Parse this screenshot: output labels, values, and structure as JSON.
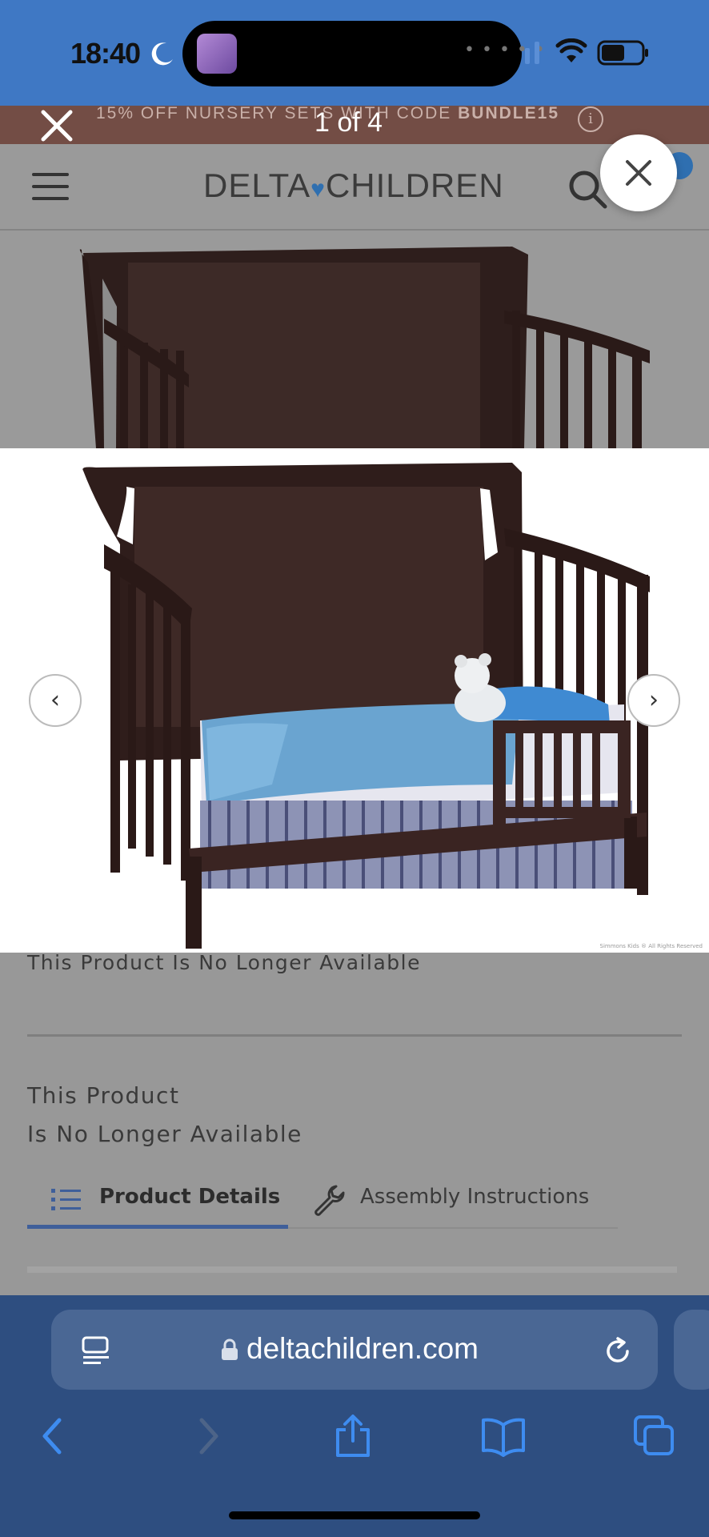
{
  "status_bar": {
    "time": "18:40",
    "battery_level": 0.6
  },
  "promo": {
    "text": "15% OFF NURSERY SETS WITH CODE",
    "code": "BUNDLE15",
    "info_icon": "i"
  },
  "viewer": {
    "counter": "1 of 4",
    "close_icon": "close-icon"
  },
  "site": {
    "logo_left": "DELTA",
    "logo_right": "CHILDREN"
  },
  "gallery": {
    "prev_icon": "‹",
    "next_icon": "›",
    "copyright": "Simmons Kids ® All Rights Reserved"
  },
  "product": {
    "unavailable_text": "This Product Is No Longer Available",
    "unavailable_line1": "This Product",
    "unavailable_line2": "Is No Longer Available"
  },
  "tabs": [
    {
      "label": "Product Details",
      "active": true
    },
    {
      "label": "Assembly Instructions",
      "active": false
    }
  ],
  "browser": {
    "url": "deltachildren.com"
  },
  "colors": {
    "accent_blue": "#2f6fb0",
    "status_bar": "#3f78c4",
    "promo_bg": "#734d45",
    "safari_bar": "#2e4e80"
  }
}
